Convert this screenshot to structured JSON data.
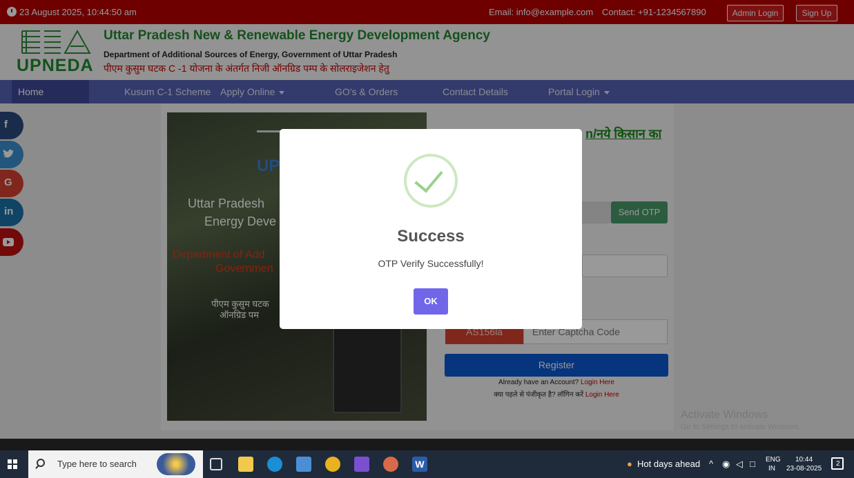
{
  "topbar": {
    "datetime": "23 August 2025, 10:44:50 am",
    "email": "Email: info@example.com",
    "contact": "Contact: +91-1234567890",
    "admin_login": "Admin Login",
    "sign_up": "Sign Up"
  },
  "header": {
    "logo_text": "UPNEDA",
    "title": "Uttar Pradesh New & Renewable Energy Development Agency",
    "department": "Department of Additional Sources of Energy, Government of Uttar Pradesh",
    "hindi_line": "पीएम कुसुम घटक C -1 योजना के अंतर्गत निजी ऑनग्रिड पम्प के सोलराइजेशन हेतु"
  },
  "nav": {
    "items": [
      "Home",
      "Kusum C-1 Scheme",
      "Apply Online",
      "GO's & Orders",
      "Contact Details",
      "Portal Login"
    ]
  },
  "social": {
    "items": [
      "f",
      "t",
      "G",
      "in",
      "yt"
    ]
  },
  "banner": {
    "logo_text": "UP",
    "line1": "Uttar Pradesh",
    "line2": "Energy Deve",
    "red1": "Department of Add",
    "red2": "Governmen",
    "hindi1": "पीएम कुसुम घटक",
    "hindi2": "ऑनग्रिड पम"
  },
  "form": {
    "title": "n/नये किसान का",
    "send_otp": "Send OTP",
    "captcha_code": "AS156la",
    "captcha_placeholder": "Enter Captcha Code",
    "register": "Register",
    "have_account": "Already have an Account?",
    "login_here": "Login Here",
    "have_account_hindi": "क्या पहले से पंजीकृत है? लॉगिन करें",
    "login_here2": "Login Here"
  },
  "watermark": {
    "line1": "Activate Windows",
    "line2": "Go to Settings to activate Windows."
  },
  "modal": {
    "title": "Success",
    "message": "OTP Verify Successfully!",
    "ok": "OK"
  },
  "taskbar": {
    "search_placeholder": "Type here to search",
    "weather": "Hot days ahead",
    "lang1": "ENG",
    "lang2": "IN",
    "time": "10:44",
    "date": "23-08-2025",
    "notifications": "2"
  },
  "colors": {
    "topbar": "#b80000",
    "nav": "#5561b4",
    "brand_green": "#23882f",
    "register": "#0b57d0",
    "ok_button": "#7166ea"
  }
}
